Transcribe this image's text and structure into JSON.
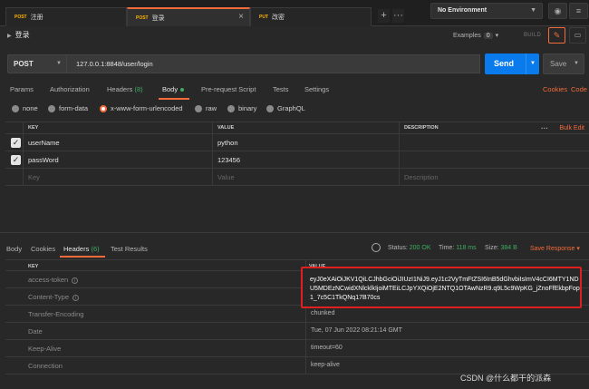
{
  "tabs": [
    {
      "method": "POST",
      "name": "注册",
      "active": false
    },
    {
      "method": "POST",
      "name": "登录",
      "active": true
    },
    {
      "method": "PUT",
      "name": "改密",
      "active": false
    }
  ],
  "tabbar": {
    "add": "+",
    "more": "···"
  },
  "environment": {
    "selected": "No Environment"
  },
  "request": {
    "title": "登录",
    "examples_label": "Examples",
    "examples_count": "0",
    "build_label": "BUILD",
    "method": "POST",
    "url": "127.0.0.1:8848/user/login",
    "send_label": "Send",
    "save_label": "Save"
  },
  "request_tabs": {
    "params": "Params",
    "authorization": "Authorization",
    "headers": "Headers",
    "headers_count": "(8)",
    "body": "Body",
    "prerequest": "Pre-request Script",
    "tests": "Tests",
    "settings": "Settings",
    "cookies": "Cookies",
    "code": "Code"
  },
  "body_types": [
    "none",
    "form-data",
    "x-www-form-urlencoded",
    "raw",
    "binary",
    "GraphQL"
  ],
  "body_type_selected": "x-www-form-urlencoded",
  "params_table": {
    "headers": {
      "key": "KEY",
      "value": "VALUE",
      "description": "DESCRIPTION",
      "bulk_edit": "Bulk Edit"
    },
    "rows": [
      {
        "key": "userName",
        "value": "python",
        "checked": true
      },
      {
        "key": "passWord",
        "value": "123456",
        "checked": true
      }
    ],
    "placeholder": {
      "key": "Key",
      "value": "Value",
      "description": "Description"
    }
  },
  "response_tabs": {
    "body": "Body",
    "cookies": "Cookies",
    "headers": "Headers",
    "headers_count": "(6)",
    "test_results": "Test Results"
  },
  "response_meta": {
    "status_label": "Status:",
    "status_value": "200 OK",
    "time_label": "Time:",
    "time_value": "118 ms",
    "size_label": "Size:",
    "size_value": "384 B",
    "save_response": "Save Response"
  },
  "response_headers": {
    "col_key": "KEY",
    "col_value": "VALUE",
    "rows": [
      {
        "key": "access-token",
        "value": ""
      },
      {
        "key": "Content-Type",
        "value": ""
      },
      {
        "key": "Transfer-Encoding",
        "value": "chunked"
      },
      {
        "key": "Date",
        "value": "Tue, 07 Jun 2022 08:21:14 GMT"
      },
      {
        "key": "Keep-Alive",
        "value": "timeout=60"
      },
      {
        "key": "Connection",
        "value": "keep-alive"
      }
    ],
    "token": "eyJ0eXAiOiJKV1QiLCJhbGciOiJIUzI1NiJ9.eyJ1c2VyTmFtZSI6InB5dGhvbiIsImV4cCI6MTY1NDU5MDEzNCwidXNlcklkIjoiMTEiLCJpYXQiOjE2NTQ1OTAwNzR9.q9L5c9WpKG_jZnoFfEkbpFop1_7c5C1TkQNq17B70cs"
  },
  "watermark": "CSDN @什么都干的派森",
  "colors": {
    "accent": "#f26b3a",
    "send": "#097bed",
    "ok": "#3dae61",
    "highlight_box": "#e02020"
  }
}
